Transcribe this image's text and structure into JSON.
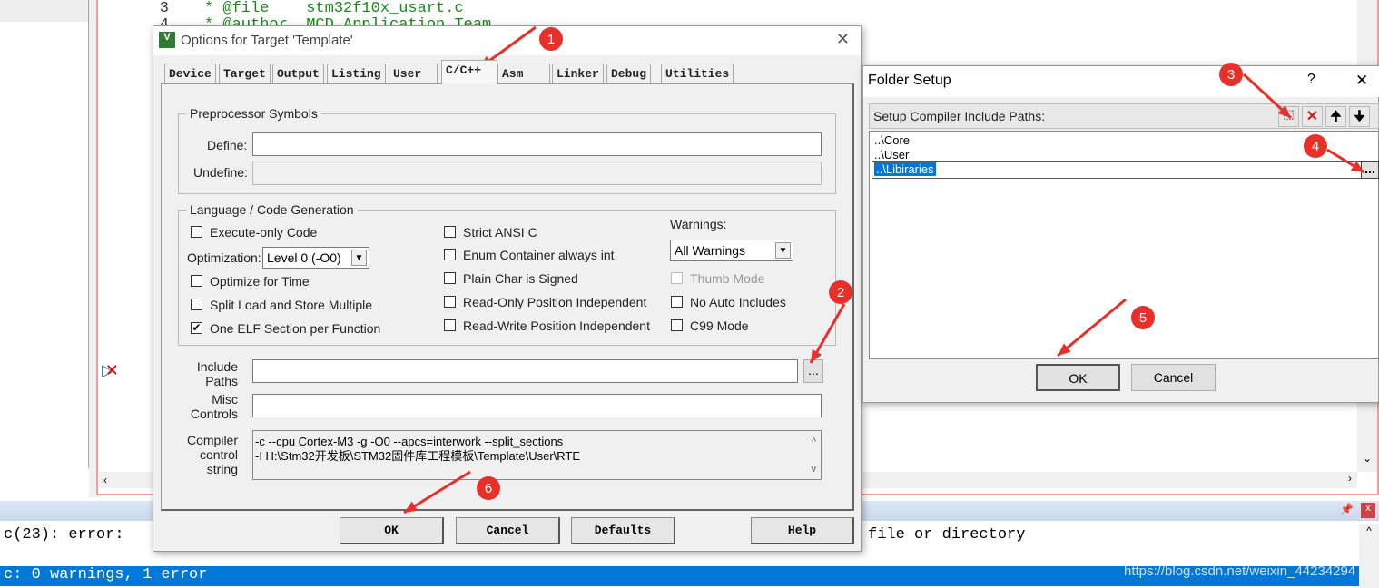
{
  "editor": {
    "lines": [
      {
        "num": "3",
        "text": "* @file    stm32f10x_usart.c"
      },
      {
        "num": "4",
        "text": "* @author  MCD Application Team"
      }
    ]
  },
  "output": {
    "error_text": "c(23): error:",
    "error_tail": "file or directory",
    "status_text": "c: 0 warnings, 1 error",
    "watermark": "https://blog.csdn.net/weixin_44234294"
  },
  "options_dialog": {
    "title": "Options for Target 'Template'",
    "tabs": [
      {
        "label": "Device"
      },
      {
        "label": "Target"
      },
      {
        "label": "Output"
      },
      {
        "label": "Listing"
      },
      {
        "label": "User"
      },
      {
        "label": "C/C++",
        "active": true
      },
      {
        "label": "Asm"
      },
      {
        "label": "Linker"
      },
      {
        "label": "Debug"
      },
      {
        "label": "Utilities"
      }
    ],
    "preprocessor": {
      "group_label": "Preprocessor Symbols",
      "define_label": "Define:",
      "define_value": "",
      "undefine_label": "Undefine:",
      "undefine_value": ""
    },
    "language": {
      "group_label": "Language / Code Generation",
      "optimization_label": "Optimization:",
      "optimization_value": "Level 0 (-O0)",
      "warnings_label": "Warnings:",
      "warnings_value": "All Warnings",
      "checkboxes_col1": [
        {
          "label": "Execute-only Code",
          "checked": false
        },
        {
          "label": "Optimize for Time",
          "checked": false
        },
        {
          "label": "Split Load and Store Multiple",
          "checked": false
        },
        {
          "label": "One ELF Section per Function",
          "checked": true
        }
      ],
      "checkboxes_col2": [
        {
          "label": "Strict ANSI C",
          "checked": false
        },
        {
          "label": "Enum Container always int",
          "checked": false
        },
        {
          "label": "Plain Char is Signed",
          "checked": false
        },
        {
          "label": "Read-Only Position Independent",
          "checked": false
        },
        {
          "label": "Read-Write Position Independent",
          "checked": false
        }
      ],
      "checkboxes_col3": [
        {
          "label": "Thumb Mode",
          "checked": false,
          "disabled": true
        },
        {
          "label": "No Auto Includes",
          "checked": false
        },
        {
          "label": "C99 Mode",
          "checked": false
        }
      ]
    },
    "include_paths_label": "Include\nPaths",
    "include_paths_value": "",
    "browse_label": "...",
    "misc_label": "Misc\nControls",
    "misc_value": "",
    "compiler_label": "Compiler\ncontrol\nstring",
    "compiler_lines": [
      "-c --cpu Cortex-M3 -g -O0 --apcs=interwork --split_sections",
      "-I H:\\Stm32开发板\\STM32固件库工程模板\\Template\\User\\RTE"
    ],
    "buttons": {
      "ok": "OK",
      "cancel": "Cancel",
      "defaults": "Defaults",
      "help": "Help"
    }
  },
  "folder_dialog": {
    "title": "Folder Setup",
    "help": "?",
    "close": "✕",
    "header_label": "Setup Compiler Include Paths:",
    "paths": [
      {
        "text": "..\\Core"
      },
      {
        "text": "..\\User"
      },
      {
        "text": "..\\Libiraries",
        "selected": true
      }
    ],
    "browse_label": "...",
    "buttons": {
      "ok": "OK",
      "cancel": "Cancel"
    }
  },
  "annotations": {
    "color": "#e8302a",
    "markers": [
      "1",
      "2",
      "3",
      "4",
      "5",
      "6"
    ]
  }
}
